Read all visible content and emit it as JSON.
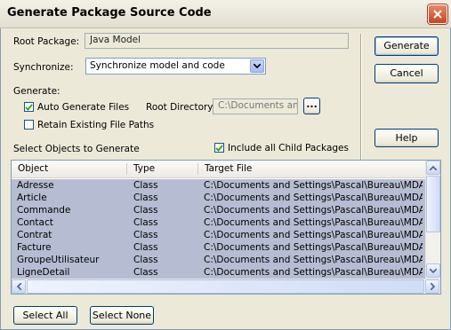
{
  "window": {
    "title": "Generate Package Source Code"
  },
  "form": {
    "root_package_label": "Root Package:",
    "root_package_value": "Java Model",
    "synchronize_label": "Synchronize:",
    "synchronize_value": "Synchronize model and code",
    "generate_label": "Generate:",
    "auto_generate_label": "Auto Generate Files",
    "auto_generate_checked": true,
    "root_directory_label": "Root Directory:",
    "root_directory_value": "C:\\Documents an",
    "browse_label": "...",
    "retain_paths_label": "Retain Existing File Paths",
    "retain_paths_checked": false,
    "select_objects_label": "Select Objects to Generate",
    "include_children_label": "Include all Child Packages",
    "include_children_checked": true
  },
  "buttons": {
    "generate": "Generate",
    "cancel": "Cancel",
    "help": "Help",
    "select_all": "Select All",
    "select_none": "Select None"
  },
  "table": {
    "columns": [
      "Object",
      "Type",
      "Target File"
    ],
    "rows": [
      [
        "Adresse",
        "Class",
        "C:\\Documents and Settings\\Pascal\\Bureau\\MDA\\J."
      ],
      [
        "Article",
        "Class",
        "C:\\Documents and Settings\\Pascal\\Bureau\\MDA\\J."
      ],
      [
        "Commande",
        "Class",
        "C:\\Documents and Settings\\Pascal\\Bureau\\MDA\\J."
      ],
      [
        "Contact",
        "Class",
        "C:\\Documents and Settings\\Pascal\\Bureau\\MDA\\J."
      ],
      [
        "Contrat",
        "Class",
        "C:\\Documents and Settings\\Pascal\\Bureau\\MDA\\J."
      ],
      [
        "Facture",
        "Class",
        "C:\\Documents and Settings\\Pascal\\Bureau\\MDA\\J."
      ],
      [
        "GroupeUtilisateur",
        "Class",
        "C:\\Documents and Settings\\Pascal\\Bureau\\MDA\\J."
      ],
      [
        "LigneDetail",
        "Class",
        "C:\\Documents and Settings\\Pascal\\Bureau\\MDA\\J."
      ]
    ]
  },
  "icons": {
    "close": "close-icon",
    "dropdown": "chevron-down-icon",
    "checkmark": "checkmark-icon",
    "scroll_up": "arrow-up-icon",
    "scroll_down": "arrow-down-icon",
    "scroll_left": "arrow-left-icon",
    "scroll_right": "arrow-right-icon"
  },
  "colors": {
    "selection": "#b6bdd2",
    "dialog_bg": "#ece9d8",
    "close_button": "#c8441c"
  }
}
